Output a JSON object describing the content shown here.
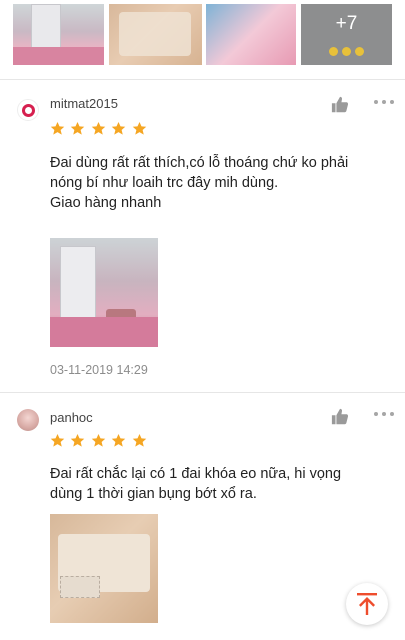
{
  "photo_strip": {
    "thumbnails": [
      "room-photo",
      "belt-photo",
      "colorful-photo"
    ],
    "more_count": "+7"
  },
  "reviews": [
    {
      "username": "mitmat2015",
      "rating": 5,
      "comment_lines": [
        "Đai dùng rất rất thích,có lỗ thoáng chứ ko phải",
        "nóng bí như loaih trc đây mih dùng.",
        "Giao hàng nhanh"
      ],
      "timestamp": "03-11-2019 14:29"
    },
    {
      "username": "panhoc",
      "rating": 5,
      "comment_lines": [
        "Đai rất chắc lại có 1 đai khóa eo nữa, hi vọng",
        "dùng 1 thời gian bụng bớt xổ ra."
      ]
    }
  ],
  "colors": {
    "star": "#f5a623",
    "accent": "#ee4d2d",
    "text": "#222222",
    "muted": "#8c8c8c"
  },
  "icons": {
    "like": "thumbs-up-icon",
    "more": "more-dots-icon",
    "scroll_top": "arrow-up-icon"
  }
}
